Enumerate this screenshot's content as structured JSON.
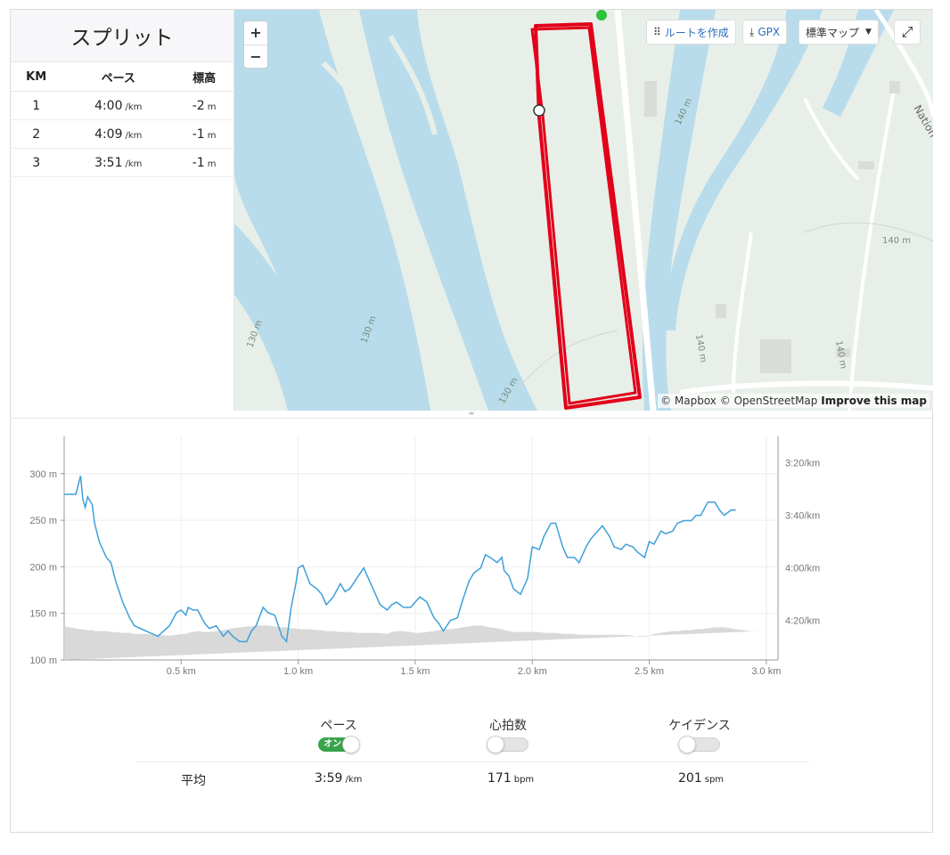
{
  "splits": {
    "title": "スプリット",
    "headers": [
      "KM",
      "ペース",
      "標高"
    ],
    "rows": [
      {
        "km": "1",
        "pace": "4:00",
        "pace_unit": "/km",
        "elev": "-2",
        "elev_unit": "m"
      },
      {
        "km": "2",
        "pace": "4:09",
        "pace_unit": "/km",
        "elev": "-1",
        "elev_unit": "m"
      },
      {
        "km": "3",
        "pace": "3:51",
        "pace_unit": "/km",
        "elev": "-1",
        "elev_unit": "m"
      }
    ]
  },
  "map": {
    "zoom_in": "+",
    "zoom_out": "−",
    "create_route": "ルートを作成",
    "gpx": "GPX",
    "map_style": "標準マップ",
    "attribution_mapbox": "© Mapbox",
    "attribution_osm": "© OpenStreetMap",
    "improve": "Improve this map",
    "contour_labels": [
      "140 m",
      "140 m",
      "140 m",
      "140 m",
      "130 m",
      "130 m",
      "130 m"
    ],
    "road_label": "Nation",
    "route_color": "#e2001a",
    "start_marker_color": "#2fc139"
  },
  "chart_data": {
    "type": "line",
    "x_ticks": [
      "0.5 km",
      "1.0 km",
      "1.5 km",
      "2.0 km",
      "2.5 km",
      "3.0 km"
    ],
    "y_left_ticks": [
      "300 m",
      "250 m",
      "200 m",
      "150 m",
      "100 m"
    ],
    "y_right_ticks": [
      "3:20/km",
      "3:40/km",
      "4:00/km",
      "4:20/km"
    ],
    "xlim": [
      0,
      3.05
    ],
    "ylim_elev": [
      100,
      340
    ],
    "pace_color": "#3ea0d8",
    "elev_color": "#d5d5d5",
    "series": [
      {
        "values_x": [
          0,
          0.05,
          0.07,
          0.08,
          0.09,
          0.1,
          0.12,
          0.13,
          0.15,
          0.18,
          0.2,
          0.22,
          0.25,
          0.28,
          0.3,
          0.35,
          0.4,
          0.45,
          0.48,
          0.5,
          0.52,
          0.53,
          0.55,
          0.57,
          0.6,
          0.62,
          0.65,
          0.68,
          0.7,
          0.72,
          0.75,
          0.78,
          0.8,
          0.82,
          0.85,
          0.87,
          0.9,
          0.93,
          0.95,
          0.97,
          0.99,
          1.0,
          1.02,
          1.05,
          1.08,
          1.1,
          1.12,
          1.15,
          1.18,
          1.2,
          1.22,
          1.25,
          1.28,
          1.3,
          1.33,
          1.35,
          1.38,
          1.4,
          1.42,
          1.45,
          1.48,
          1.5,
          1.52,
          1.55,
          1.58,
          1.6,
          1.62,
          1.65,
          1.68,
          1.7,
          1.73,
          1.75,
          1.78,
          1.8,
          1.82,
          1.85,
          1.87,
          1.88,
          1.9,
          1.92,
          1.95,
          1.98,
          2.0,
          2.03,
          2.05,
          2.08,
          2.1,
          2.13,
          2.15,
          2.18,
          2.2,
          2.23,
          2.25,
          2.28,
          2.3,
          2.33,
          2.35,
          2.38,
          2.4,
          2.43,
          2.45,
          2.48,
          2.5,
          2.52,
          2.55,
          2.57,
          2.6,
          2.62,
          2.65,
          2.68,
          2.7,
          2.72,
          2.75,
          2.78,
          2.8,
          2.82,
          2.85,
          2.87,
          2.9,
          2.93,
          2.95,
          2.97,
          3.0,
          3.02
        ],
        "pace_sec": [
          212,
          212,
          205,
          214,
          217,
          213,
          216,
          223,
          230,
          236,
          238,
          245,
          253,
          259,
          262,
          264,
          266,
          262,
          257,
          256,
          258,
          255,
          256,
          256,
          261,
          263,
          262,
          266,
          264,
          266,
          268,
          268,
          264,
          262,
          255,
          257,
          258,
          266,
          268,
          255,
          246,
          240,
          239,
          246,
          248,
          250,
          254,
          251,
          246,
          249,
          248,
          244,
          240,
          244,
          250,
          254,
          256,
          254,
          253,
          255,
          255,
          253,
          251,
          253,
          259,
          261,
          264,
          260,
          259,
          253,
          245,
          242,
          240,
          235,
          236,
          238,
          236,
          241,
          243,
          248,
          250,
          244,
          232,
          233,
          228,
          223,
          223,
          232,
          236,
          236,
          238,
          232,
          229,
          226,
          224,
          228,
          232,
          233,
          231,
          232,
          234,
          236,
          230,
          231,
          226,
          227,
          226,
          223,
          222,
          222,
          220,
          220,
          215,
          215,
          218,
          220,
          218,
          218
        ],
        "elev_m": [
          136,
          134,
          133,
          133,
          132,
          132,
          132,
          131,
          131,
          131,
          130,
          130,
          129,
          129,
          128,
          128,
          127,
          126,
          127,
          128,
          128,
          129,
          130,
          131,
          130,
          130,
          131,
          132,
          133,
          134,
          135,
          136,
          136,
          137,
          137,
          137,
          136,
          135,
          135,
          134,
          134,
          133,
          133,
          133,
          132,
          132,
          131,
          131,
          130,
          130,
          130,
          129,
          129,
          129,
          129,
          129,
          128,
          130,
          131,
          131,
          130,
          129,
          129,
          130,
          131,
          132,
          133,
          133,
          134,
          135,
          136,
          137,
          137,
          136,
          135,
          134,
          133,
          132,
          131,
          130,
          130,
          130,
          130,
          130,
          129,
          129,
          129,
          128,
          128,
          128,
          127,
          127,
          127,
          127,
          127,
          127,
          127,
          127,
          127,
          126,
          125,
          125,
          126,
          128,
          129,
          130,
          131,
          131,
          132,
          132,
          133,
          133,
          134,
          135,
          135,
          135,
          134,
          133,
          132,
          131,
          131,
          131
        ]
      }
    ]
  },
  "toggles": [
    {
      "label": "ペース",
      "state": "on",
      "on_text": "オン"
    },
    {
      "label": "心拍数",
      "state": "off",
      "on_text": ""
    },
    {
      "label": "ケイデンス",
      "state": "off",
      "on_text": ""
    }
  ],
  "averages": {
    "label": "平均",
    "pace": "3:59",
    "pace_unit": "/km",
    "hr": "171",
    "hr_unit": "bpm",
    "cadence": "201",
    "cadence_unit": "spm"
  }
}
